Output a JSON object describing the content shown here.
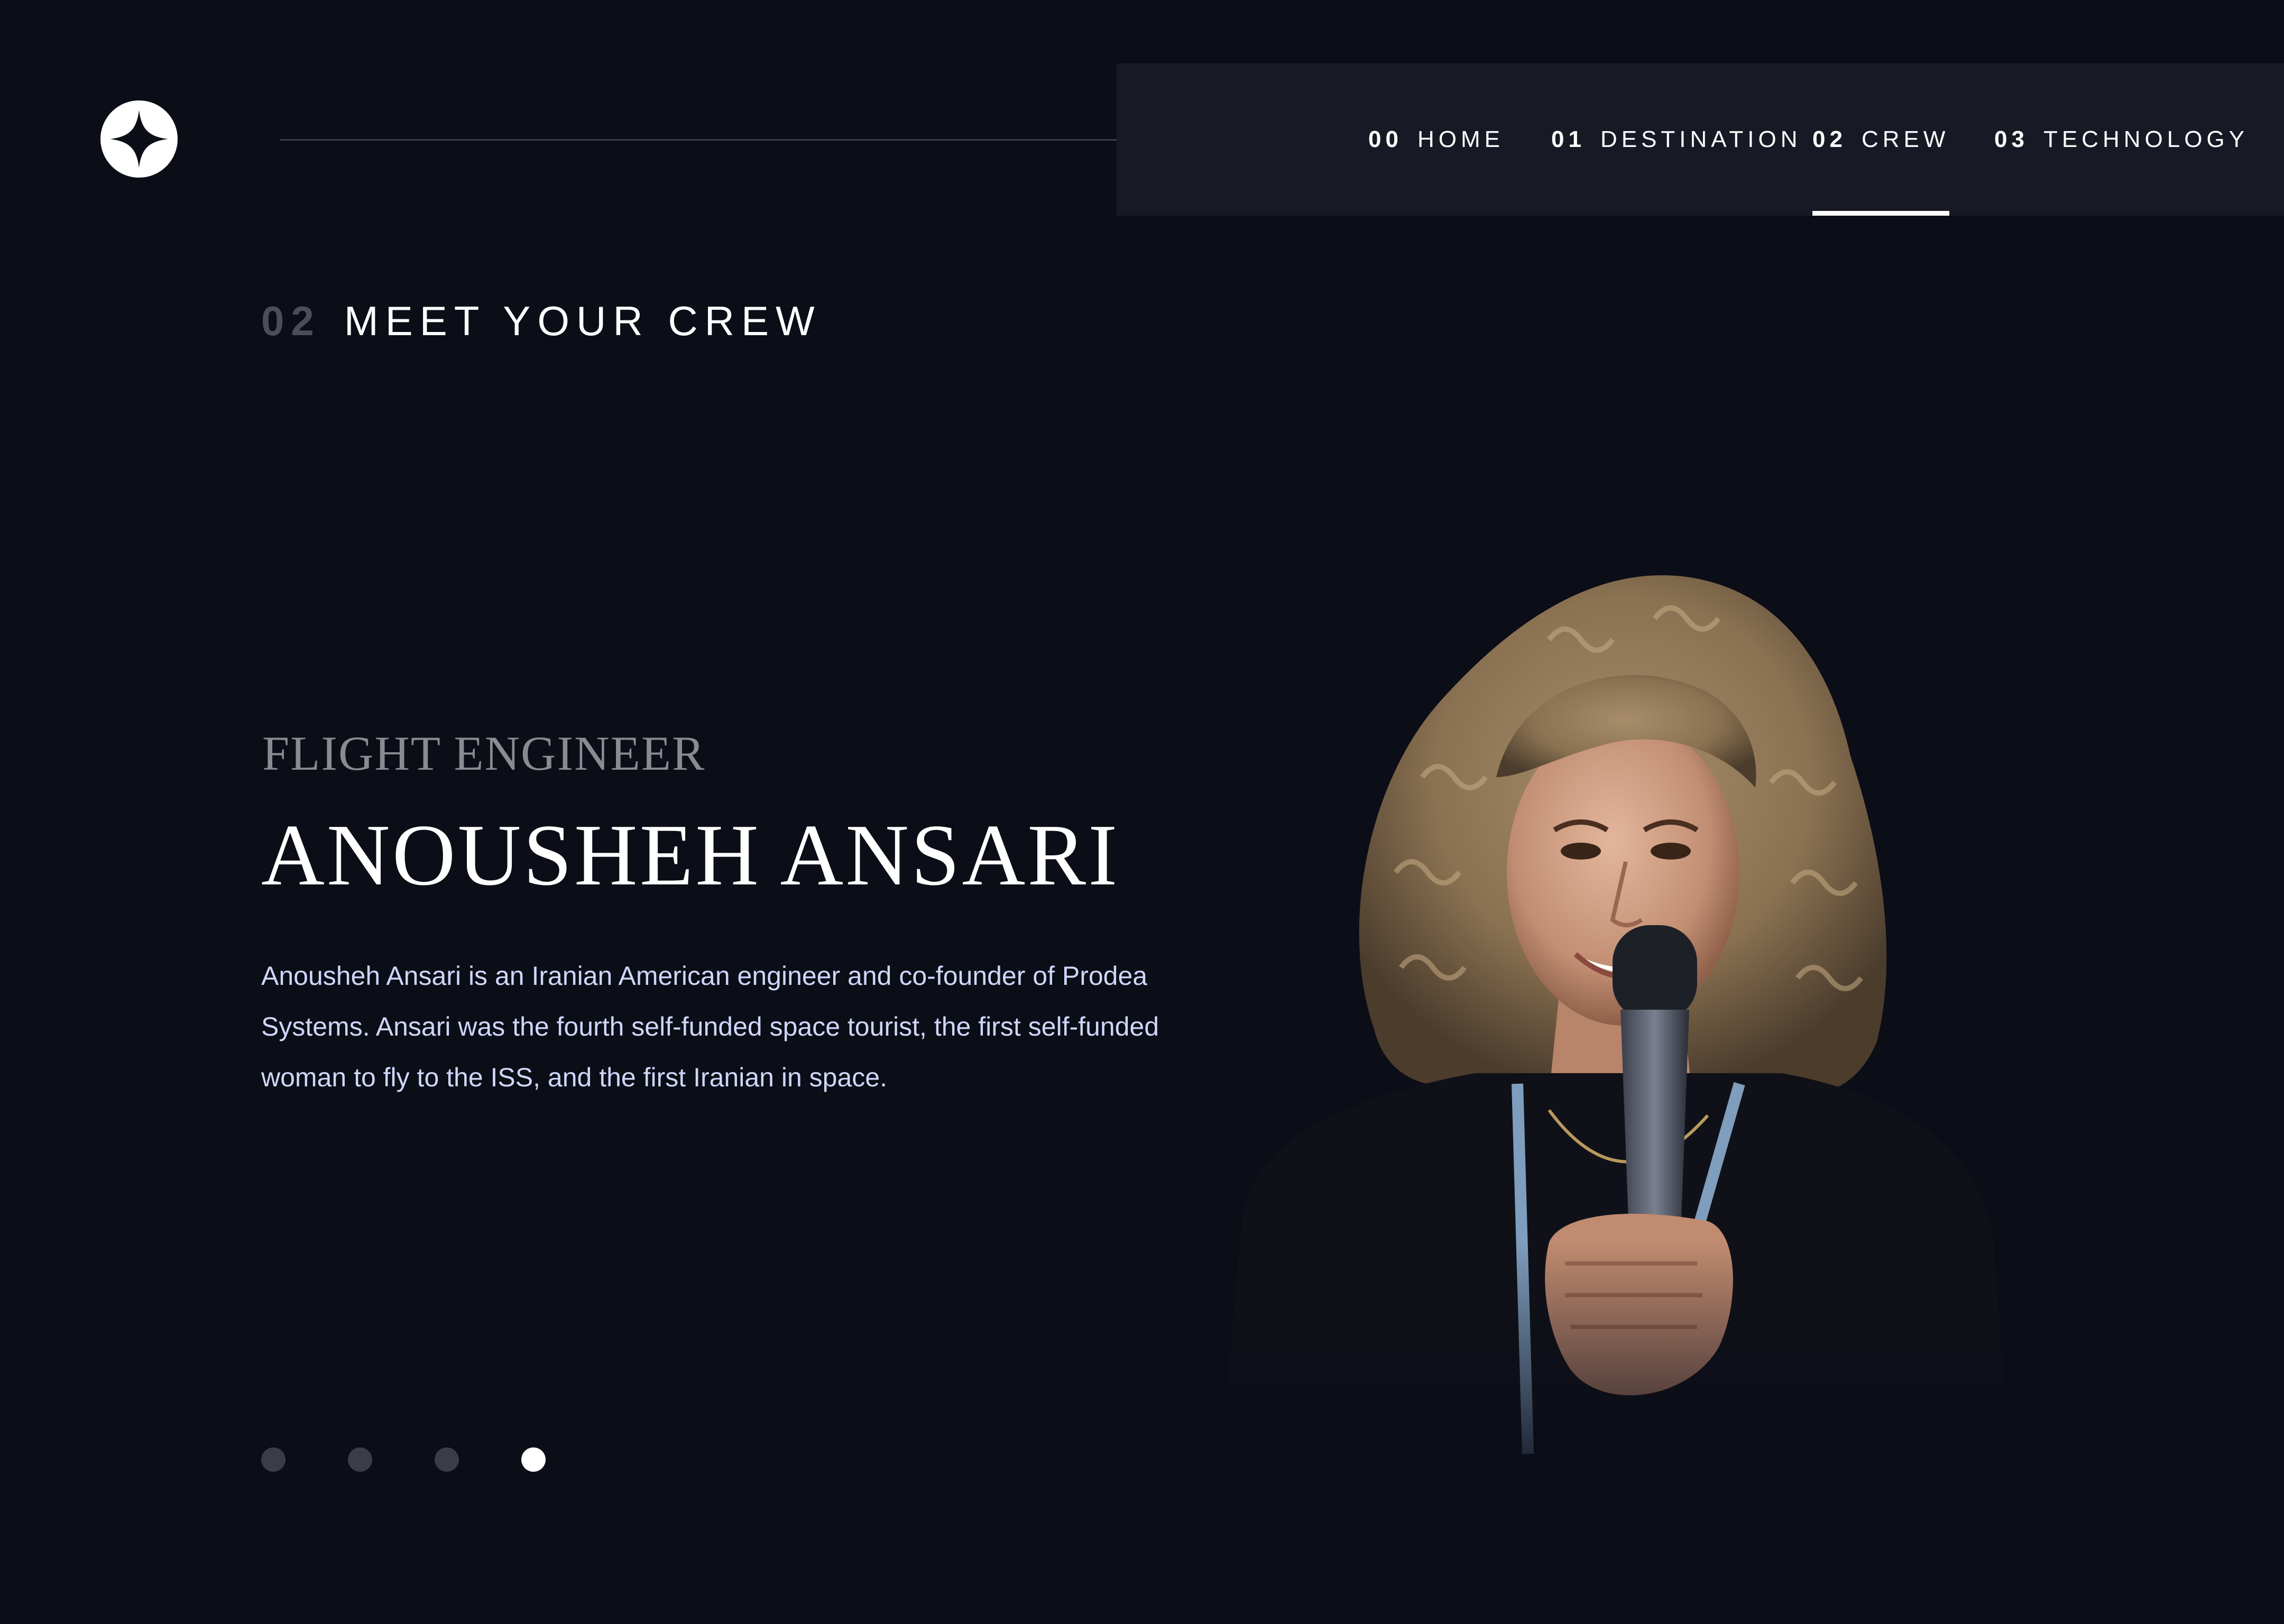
{
  "nav": {
    "items": [
      {
        "num": "00",
        "label": "HOME",
        "active": false
      },
      {
        "num": "01",
        "label": "DESTINATION",
        "active": false
      },
      {
        "num": "02",
        "label": "CREW",
        "active": true
      },
      {
        "num": "03",
        "label": "TECHNOLOGY",
        "active": false
      }
    ]
  },
  "page": {
    "heading_num": "02",
    "heading_text": "MEET YOUR CREW"
  },
  "crew": {
    "role": "FLIGHT ENGINEER",
    "name": "ANOUSHEH ANSARI",
    "bio": "Anousheh Ansari is an Iranian American engineer and co-founder of Prodea Systems. Ansari was the fourth self-funded space tourist, the first self-funded woman to fly to the ISS, and the first Iranian in space.",
    "slides": [
      {
        "active": false
      },
      {
        "active": false
      },
      {
        "active": false
      },
      {
        "active": true
      }
    ]
  },
  "colors": {
    "background": "#0b0d17",
    "nav_panel": "#171a24",
    "text_primary": "#ffffff",
    "text_body": "#d0d6f9",
    "text_muted": "#8a8b90",
    "dot_inactive": "#3a3c47",
    "dot_active": "#ffffff"
  },
  "icons": {
    "logo": "four-point-star-logo"
  }
}
